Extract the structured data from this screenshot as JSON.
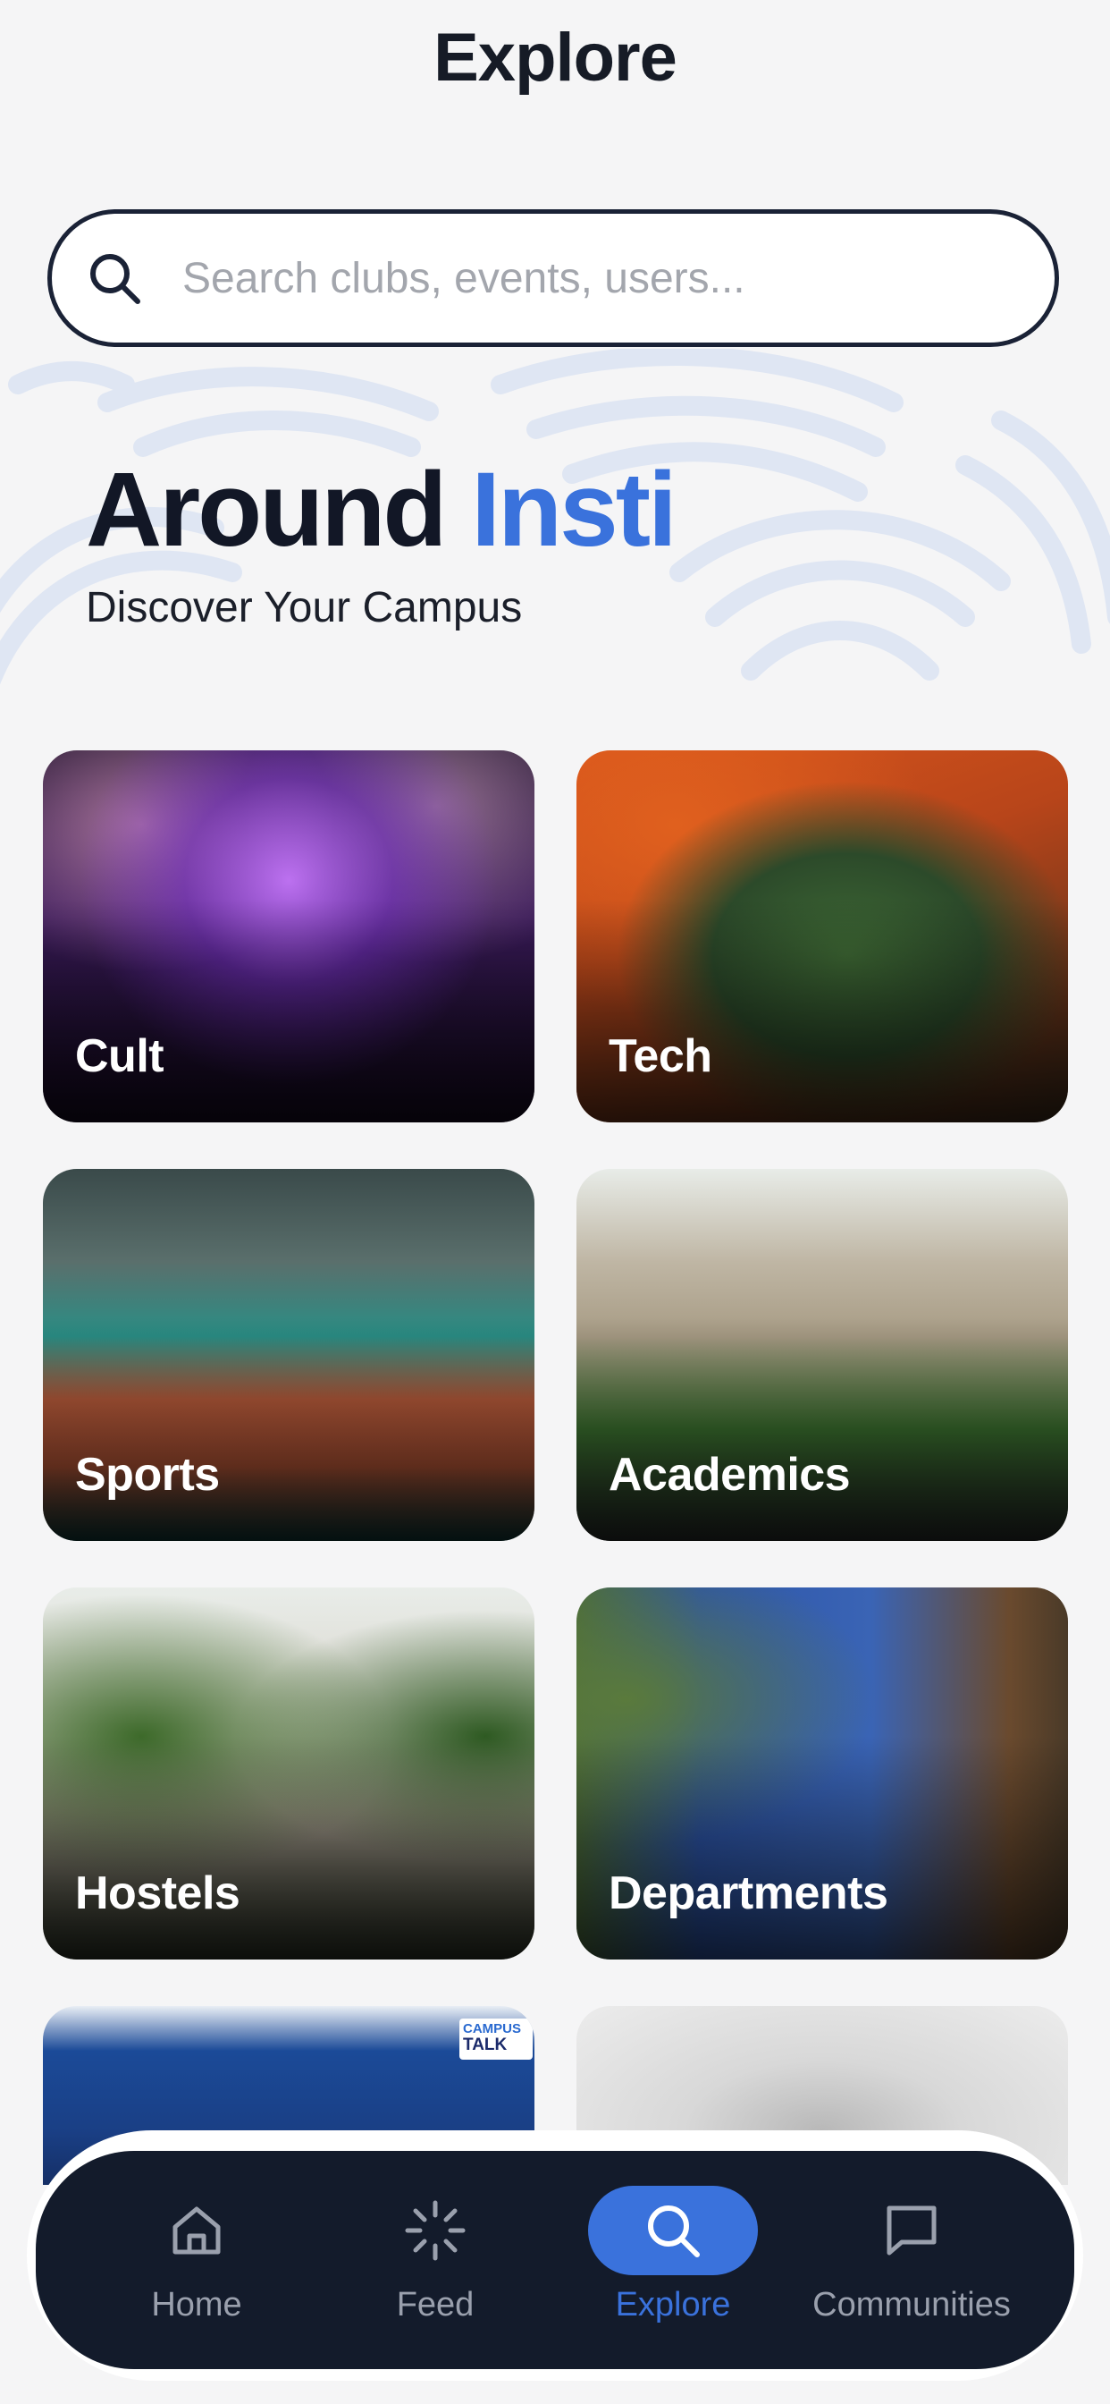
{
  "header": {
    "title": "Explore"
  },
  "search": {
    "placeholder": "Search clubs, events, users..."
  },
  "hero": {
    "title_part1": "Around",
    "title_part2": "Insti",
    "subtitle": "Discover Your Campus",
    "accent_color": "#3a72dc"
  },
  "categories": [
    {
      "label": "Cult"
    },
    {
      "label": "Tech"
    },
    {
      "label": "Sports"
    },
    {
      "label": "Academics"
    },
    {
      "label": "Hostels"
    },
    {
      "label": "Departments"
    },
    {
      "label": ""
    },
    {
      "label": ""
    }
  ],
  "campus_talk_logo": {
    "line1": "CAMPUS",
    "line2": "TALK"
  },
  "bottom_nav": {
    "active": "Explore",
    "items": [
      {
        "label": "Home",
        "icon": "home-icon"
      },
      {
        "label": "Feed",
        "icon": "feed-icon"
      },
      {
        "label": "Explore",
        "icon": "search-icon"
      },
      {
        "label": "Communities",
        "icon": "chat-icon"
      }
    ]
  }
}
